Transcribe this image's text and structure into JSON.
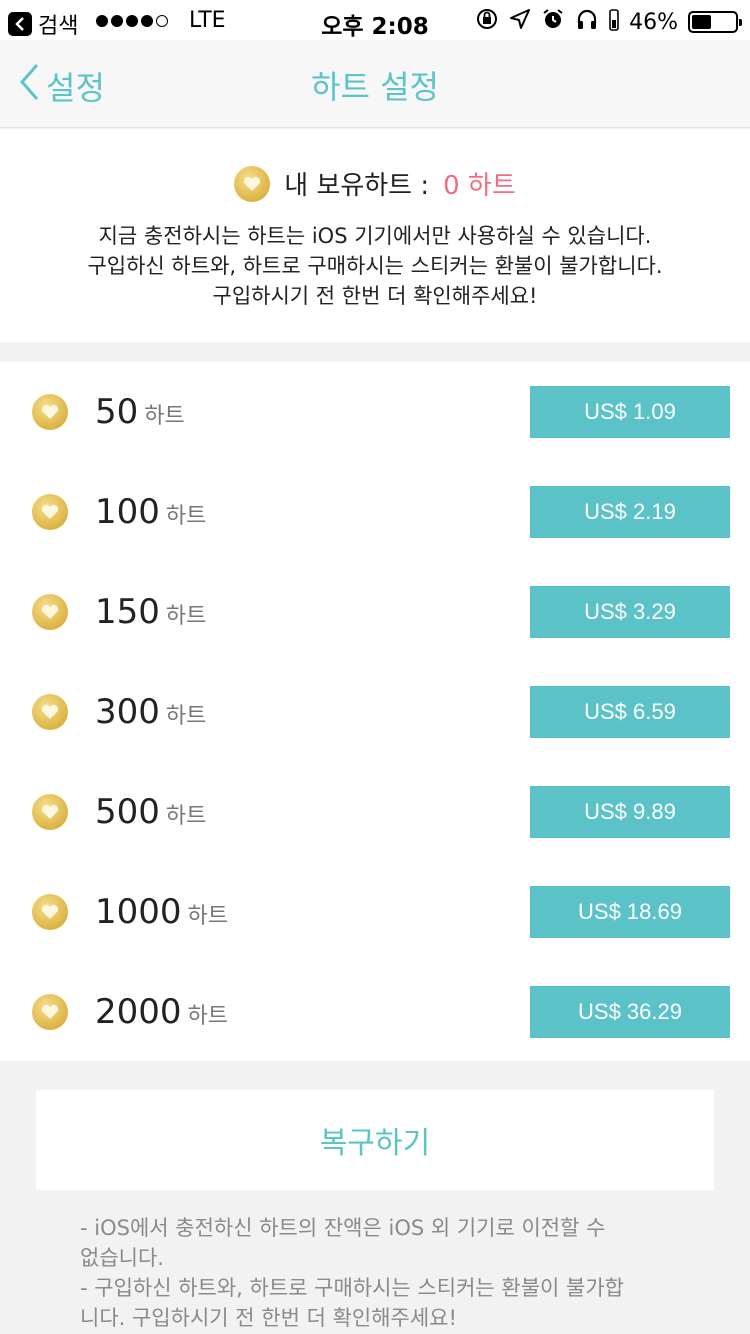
{
  "status_bar": {
    "back_app": "검색",
    "network": "LTE",
    "time": "오후 2:08",
    "battery": "46%",
    "battery_level": 0.46
  },
  "nav": {
    "back_label": "설정",
    "title": "하트 설정"
  },
  "info": {
    "holding_label": "내 보유하트 :",
    "holding_count": "0 하트",
    "notice_lines": [
      "지금 충전하시는 하트는 iOS 기기에서만 사용하실 수 있습니다.",
      "구입하신 하트와, 하트로 구매하시는 스티커는 환불이 불가합니다.",
      "구입하시기 전 한번 더 확인해주세요!"
    ]
  },
  "products": [
    {
      "amount": "50",
      "unit": "하트",
      "price": "US$ 1.09"
    },
    {
      "amount": "100",
      "unit": "하트",
      "price": "US$ 2.19"
    },
    {
      "amount": "150",
      "unit": "하트",
      "price": "US$ 3.29"
    },
    {
      "amount": "300",
      "unit": "하트",
      "price": "US$ 6.59"
    },
    {
      "amount": "500",
      "unit": "하트",
      "price": "US$ 9.89"
    },
    {
      "amount": "1000",
      "unit": "하트",
      "price": "US$ 18.69"
    },
    {
      "amount": "2000",
      "unit": "하트",
      "price": "US$ 36.29"
    }
  ],
  "restore_label": "복구하기",
  "footer_lines": [
    "- iOS에서 충전하신 하트의 잔액은 iOS 외 기기로 이전할 수",
    "없습니다.",
    "- 구입하신 하트와, 하트로 구매하시는 스티커는 환불이 불가합",
    "니다. 구입하시기 전 한번 더 확인해주세요!"
  ],
  "colors": {
    "accent": "#5bc4c9",
    "button": "#5bc2c8",
    "heart_count": "#ef6f80",
    "coin": "#dcb444"
  }
}
